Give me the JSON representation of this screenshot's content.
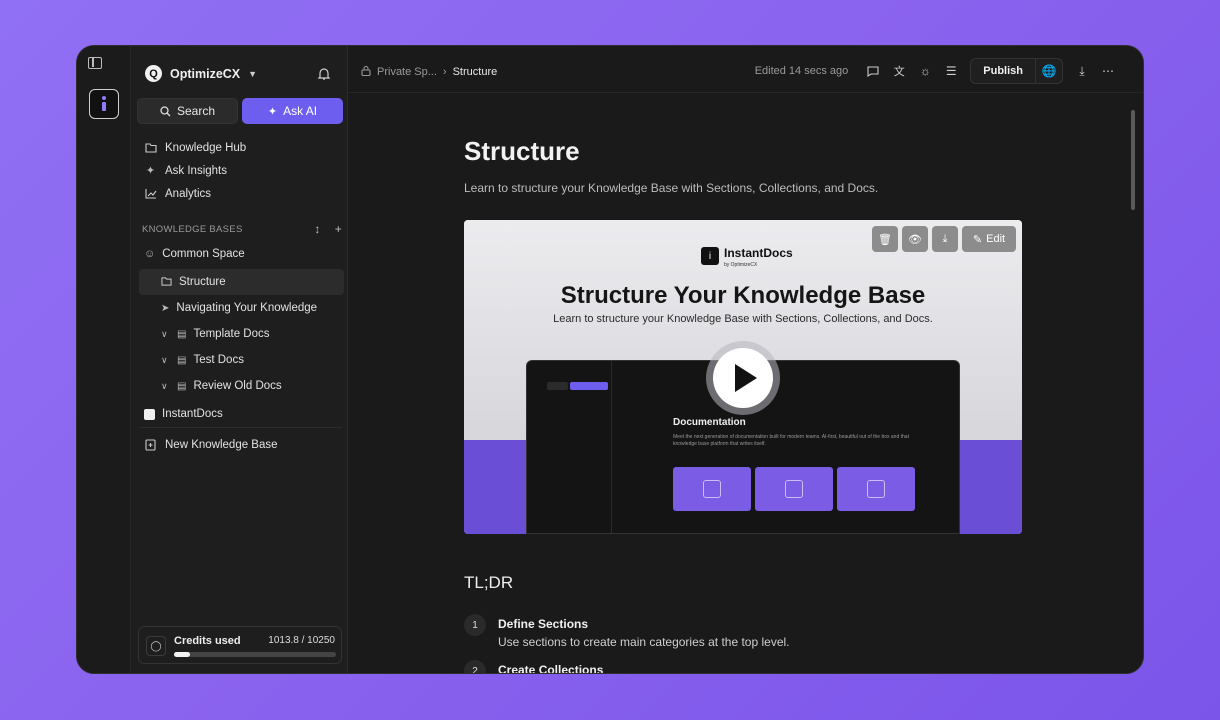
{
  "sidebar": {
    "org_name": "OptimizeCX",
    "search_label": "Search",
    "ask_ai_label": "Ask AI",
    "nav": [
      {
        "label": "Knowledge Hub",
        "icon": "folder-icon"
      },
      {
        "label": "Ask Insights",
        "icon": "sparkle-icon"
      },
      {
        "label": "Analytics",
        "icon": "chart-icon"
      }
    ],
    "kb_heading": "KNOWLEDGE BASES",
    "tree": {
      "common_space": "Common Space",
      "structure": "Structure",
      "navigating": "Navigating Your Knowledge",
      "template_docs": "Template Docs",
      "test_docs": "Test Docs",
      "review_old_docs": "Review Old Docs",
      "instantdocs": "InstantDocs"
    },
    "new_kb": "New Knowledge Base",
    "credits": {
      "label": "Credits used",
      "value": "1013.8 / 10250",
      "fraction": 0.099
    }
  },
  "topbar": {
    "crumb_parent": "Private Sp...",
    "crumb_current": "Structure",
    "edited": "Edited 14 secs ago",
    "publish": "Publish"
  },
  "page": {
    "title": "Structure",
    "subtitle": "Learn to structure your Knowledge Base with Sections, Collections, and Docs.",
    "video": {
      "brand": "InstantDocs",
      "brand_by": "by OptimizeCX",
      "heading": "Structure Your Knowledge Base",
      "subheading": "Learn to structure your Knowledge Base with Sections, Collections, and Docs.",
      "edit_label": "Edit",
      "app_doc_title": "Documentation",
      "app_doc_sub": "Meet the next generation of documentation built for modern teams. AI-first, beautiful out of the box and that knowledge base platform that writes itself."
    },
    "tldr": "TL;DR",
    "steps": [
      {
        "num": "1",
        "title": "Define Sections",
        "desc": "Use sections to create main categories at the top level."
      },
      {
        "num": "2",
        "title": "Create Collections",
        "desc": ""
      }
    ]
  },
  "colors": {
    "accent": "#6d5ef0",
    "background": "#8a63ee"
  }
}
